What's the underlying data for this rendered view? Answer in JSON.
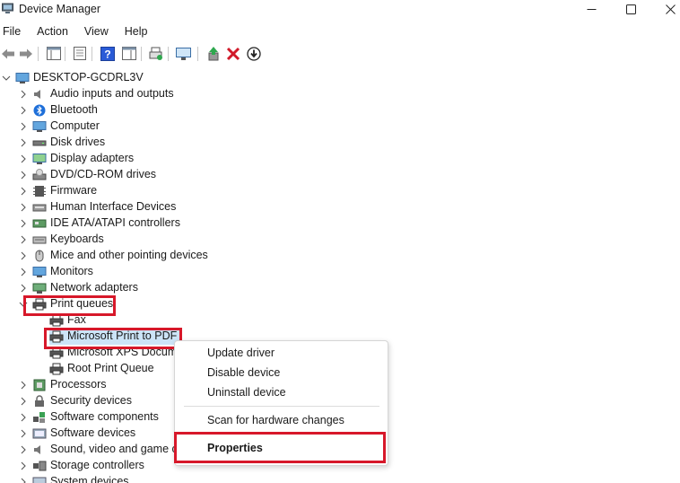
{
  "window": {
    "title": "Device Manager",
    "controls": {
      "minimize": "minimize",
      "maximize": "maximize",
      "close": "close"
    }
  },
  "menubar": [
    "File",
    "Action",
    "View",
    "Help"
  ],
  "tree": {
    "root": "DESKTOP-GCDRL3V",
    "categories": [
      {
        "label": "Audio inputs and outputs",
        "icon": "speaker-icon"
      },
      {
        "label": "Bluetooth",
        "icon": "bluetooth-icon"
      },
      {
        "label": "Computer",
        "icon": "computer-icon"
      },
      {
        "label": "Disk drives",
        "icon": "disk-drive-icon"
      },
      {
        "label": "Display adapters",
        "icon": "display-adapter-icon"
      },
      {
        "label": "DVD/CD-ROM drives",
        "icon": "dvd-drive-icon"
      },
      {
        "label": "Firmware",
        "icon": "firmware-icon"
      },
      {
        "label": "Human Interface Devices",
        "icon": "hid-icon"
      },
      {
        "label": "IDE ATA/ATAPI controllers",
        "icon": "ide-controller-icon"
      },
      {
        "label": "Keyboards",
        "icon": "keyboard-icon"
      },
      {
        "label": "Mice and other pointing devices",
        "icon": "mouse-icon"
      },
      {
        "label": "Monitors",
        "icon": "monitor-icon"
      },
      {
        "label": "Network adapters",
        "icon": "network-adapter-icon"
      },
      {
        "label": "Print queues",
        "icon": "printer-icon",
        "expanded": true
      }
    ],
    "print_queue_children": [
      "Fax",
      "Microsoft Print to PDF",
      "Microsoft XPS Docume",
      "Root Print Queue"
    ],
    "categories_after": [
      {
        "label": "Processors",
        "icon": "processor-icon"
      },
      {
        "label": "Security devices",
        "icon": "security-device-icon"
      },
      {
        "label": "Software components",
        "icon": "software-component-icon"
      },
      {
        "label": "Software devices",
        "icon": "software-device-icon"
      },
      {
        "label": "Sound, video and game co",
        "icon": "sound-video-icon"
      },
      {
        "label": "Storage controllers",
        "icon": "storage-controller-icon"
      },
      {
        "label": "System devices",
        "icon": "system-device-icon"
      }
    ]
  },
  "context_menu": {
    "items": [
      "Update driver",
      "Disable device",
      "Uninstall device"
    ],
    "scan": "Scan for hardware changes",
    "properties": "Properties"
  },
  "colors": {
    "highlight": "#d7182a",
    "selection": "#cce4f7",
    "accent_blue": "#1e6fd9"
  }
}
